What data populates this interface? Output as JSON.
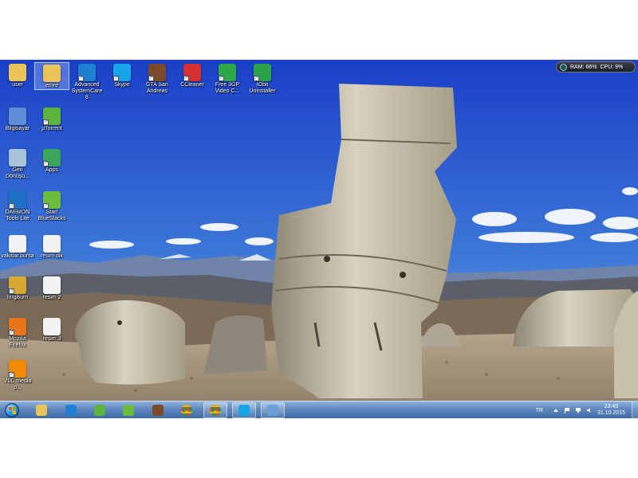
{
  "desktop": {
    "icons": [
      {
        "id": "user",
        "label": "user",
        "icon": "folder-icon",
        "color": "#e8c45a",
        "col": 0,
        "row": 0
      },
      {
        "id": "emre",
        "label": "emre",
        "icon": "folder-icon",
        "color": "#e8c45a",
        "col": 1,
        "row": 0,
        "selected": true
      },
      {
        "id": "advanced-systemcare",
        "label": "Advanced SystemCare 8",
        "icon": "advanced-systemcare-icon",
        "color": "#1f7fd1",
        "col": 2,
        "row": 0
      },
      {
        "id": "skype",
        "label": "Skype",
        "icon": "skype-icon",
        "color": "#16a5e8",
        "col": 3,
        "row": 0
      },
      {
        "id": "gta-san-andreas",
        "label": "GTA San Andreas",
        "icon": "gta-san-andreas-icon",
        "color": "#7a4a2a",
        "col": 4,
        "row": 0
      },
      {
        "id": "ccleaner",
        "label": "CCleaner",
        "icon": "ccleaner-icon",
        "color": "#d62f2f",
        "col": 5,
        "row": 0
      },
      {
        "id": "free-3gp",
        "label": "Free 3GP Video C...",
        "icon": "video-converter-icon",
        "color": "#2fa84a",
        "col": 6,
        "row": 0
      },
      {
        "id": "iobit-uninstaller",
        "label": "IObit Uninstaller",
        "icon": "iobit-uninstaller-icon",
        "color": "#2aa34a",
        "col": 7,
        "row": 0
      },
      {
        "id": "bilgisayar",
        "label": "Bilgisayar",
        "icon": "computer-icon",
        "color": "#5c8fd6",
        "col": 0,
        "row": 1
      },
      {
        "id": "utorrent",
        "label": "µTorrent",
        "icon": "utorrent-icon",
        "color": "#5bb53c",
        "col": 1,
        "row": 1
      },
      {
        "id": "geri-donusum",
        "label": "Geri Dönüşü...",
        "icon": "recycle-bin-icon",
        "color": "#a8c4da",
        "col": 0,
        "row": 2
      },
      {
        "id": "apps",
        "label": "Apps",
        "icon": "bluestacks-apps-icon",
        "color": "#3aa65a",
        "col": 1,
        "row": 2
      },
      {
        "id": "daemon-tools",
        "label": "DAEMON Tools Lite",
        "icon": "daemon-tools-icon",
        "color": "#1e6fc6",
        "col": 0,
        "row": 3
      },
      {
        "id": "start-bluestacks",
        "label": "Start BlueStacks",
        "icon": "bluestacks-icon",
        "color": "#6cbd3d",
        "col": 1,
        "row": 3
      },
      {
        "id": "vakitlar",
        "label": "vakitlar.bursa",
        "icon": "document-icon",
        "color": "#f2f2f2",
        "col": 0,
        "row": 4
      },
      {
        "id": "resim-dik",
        "label": "resim dik",
        "icon": "image-file-icon",
        "color": "#f2f2f2",
        "col": 1,
        "row": 4
      },
      {
        "id": "imgburn",
        "label": "ImgBurn",
        "icon": "imgburn-icon",
        "color": "#d8a830",
        "col": 0,
        "row": 5
      },
      {
        "id": "resim-2",
        "label": "resim 2",
        "icon": "image-file-icon",
        "color": "#f2f2f2",
        "col": 1,
        "row": 5
      },
      {
        "id": "mozilla-firefox",
        "label": "Mozilla Firefox",
        "icon": "firefox-icon",
        "color": "#e8751a",
        "col": 0,
        "row": 6
      },
      {
        "id": "resim-3",
        "label": "resim 3",
        "icon": "image-file-icon",
        "color": "#f2f2f2",
        "col": 1,
        "row": 6
      },
      {
        "id": "vlc",
        "label": "VLC media p...",
        "icon": "vlc-icon",
        "color": "#f08a00",
        "col": 0,
        "row": 7
      }
    ]
  },
  "gadget": {
    "ram": "RAM: 66%",
    "cpu": "CPU: 9%",
    "icon": "system-monitor-icon"
  },
  "taskbar": {
    "start_icon": "windows-start-icon",
    "items": [
      {
        "id": "explorer",
        "icon": "file-explorer-icon",
        "color": "#e8c45a",
        "open": false
      },
      {
        "id": "advanced-systemcare",
        "icon": "advanced-systemcare-icon",
        "color": "#1f7fd1",
        "open": false
      },
      {
        "id": "utorrent",
        "icon": "utorrent-icon",
        "color": "#5bb53c",
        "open": false
      },
      {
        "id": "bluestacks",
        "icon": "bluestacks-icon",
        "color": "#6cbd3d",
        "open": false
      },
      {
        "id": "gta-san-andreas",
        "icon": "gta-san-andreas-icon",
        "color": "#7a4a2a",
        "open": false
      },
      {
        "id": "chrome-1",
        "icon": "chrome-icon",
        "color": "#db4437",
        "open": false
      },
      {
        "id": "chrome-2",
        "icon": "chrome-icon",
        "color": "#db4437",
        "open": true
      },
      {
        "id": "skype",
        "icon": "skype-icon",
        "color": "#16a5e8",
        "open": true
      },
      {
        "id": "network-app",
        "icon": "network-app-icon",
        "color": "#6aa0d8",
        "open": true
      }
    ],
    "tray": {
      "language": "TR",
      "time": "23:40",
      "date": "31.10.2015"
    }
  }
}
